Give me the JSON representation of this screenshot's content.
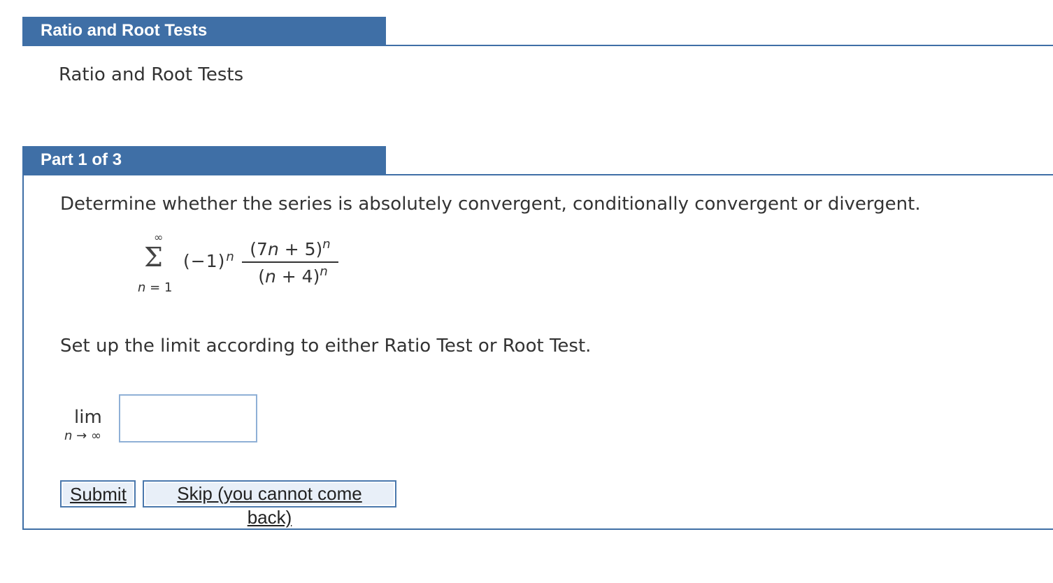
{
  "headers": {
    "section_title": "Ratio and Root Tests",
    "part_label": "Part 1 of 3"
  },
  "intro": {
    "text": "Ratio and Root Tests"
  },
  "question": {
    "prompt": "Determine whether the series is absolutely convergent, conditionally convergent or divergent.",
    "series": {
      "upper_limit": "∞",
      "sigma": "Σ",
      "index_var": "n",
      "lower_bound_text": " = 1",
      "sign_base": "(−1)",
      "sign_exponent": "n",
      "numerator_base_open": "(7",
      "numerator_var": "n",
      "numerator_base_close": " + 5)",
      "numerator_exponent": "n",
      "denominator_base_open": "(",
      "denominator_var": "n",
      "denominator_base_close": " + 4)",
      "denominator_exponent": "n"
    },
    "setup_prompt": "Set up the limit according to either Ratio Test or Root Test."
  },
  "limit": {
    "lim_word": "lim",
    "sub_var": "n",
    "sub_arrow": " → ∞",
    "answer_value": ""
  },
  "buttons": {
    "submit_label": "Submit",
    "skip_label": "Skip (you cannot come back)"
  },
  "colors": {
    "header_bg": "#3f6fa6",
    "header_text": "#ffffff",
    "input_border": "#8fb0d6",
    "button_border": "#4a78ad"
  }
}
